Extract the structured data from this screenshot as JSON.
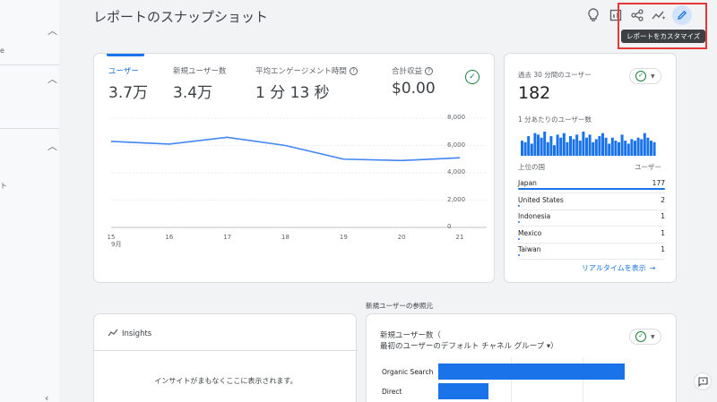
{
  "sidebar": {
    "partial_text_1": "e",
    "partial_text_2": "ト"
  },
  "header": {
    "title": "レポートのスナップショット",
    "tooltip": "レポートをカスタマイズ"
  },
  "metrics": [
    {
      "label": "ユーザー",
      "value": "3.7万"
    },
    {
      "label": "新規ユーザー数",
      "value": "3.4万"
    },
    {
      "label": "平均エンゲージメント時間",
      "value": "1 分 13 秒"
    },
    {
      "label": "合計収益",
      "value": "$0.00"
    }
  ],
  "chart_data": {
    "type": "line",
    "x": [
      "15",
      "16",
      "17",
      "18",
      "19",
      "20",
      "21"
    ],
    "x_month_label": "9月",
    "series": [
      {
        "values": [
          6300,
          6100,
          6600,
          6000,
          5000,
          4900,
          5100
        ]
      }
    ],
    "yticks": [
      "8,000",
      "6,000",
      "4,000",
      "2,000",
      "0"
    ],
    "ylim": [
      0,
      8000
    ],
    "color": "#4285f4"
  },
  "realtime": {
    "title": "過去 30 分間のユーザー",
    "value": "182",
    "per_minute_label": "1 分あたりのユーザー数",
    "minute_counts": [
      10,
      9,
      13,
      8,
      15,
      14,
      12,
      16,
      9,
      13,
      7,
      14,
      12,
      15,
      9,
      13,
      11,
      14,
      10,
      16,
      12,
      14,
      9,
      11,
      13,
      15,
      12,
      8,
      12,
      10,
      9,
      14,
      10,
      8,
      11,
      10,
      12,
      11,
      15,
      12,
      10,
      9
    ],
    "col_country": "上位の国",
    "col_users": "ユーザー",
    "countries": [
      {
        "name": "Japan",
        "count": "177",
        "share": 1.0
      },
      {
        "name": "United States",
        "count": "2",
        "share": 0.011
      },
      {
        "name": "Indonesia",
        "count": "1",
        "share": 0.006
      },
      {
        "name": "Mexico",
        "count": "1",
        "share": 0.006
      },
      {
        "name": "Taiwan",
        "count": "1",
        "share": 0.006
      }
    ],
    "link": "リアルタイムを表示"
  },
  "insights": {
    "title": "Insights",
    "empty_message": "インサイトがまもなくここに表示されます。"
  },
  "acquisition": {
    "section_label": "新規ユーザーの参照元",
    "title_line1": "新規ユーザー数（",
    "title_line2": "最初のユーザーのデフォルト チャネル グループ ▾）",
    "rows": [
      {
        "label": "Organic Search",
        "share": 1.0
      },
      {
        "label": "Direct",
        "share": 0.27
      }
    ]
  },
  "colors": {
    "accent": "#1a73e8",
    "highlight_box": "#e53935",
    "success": "#188038"
  }
}
